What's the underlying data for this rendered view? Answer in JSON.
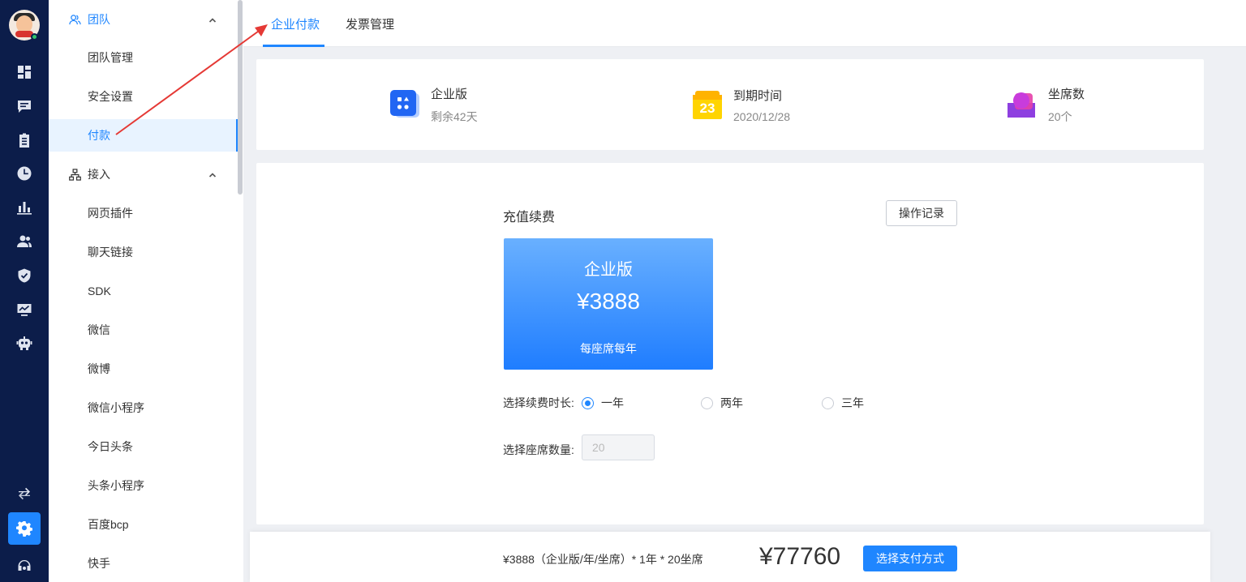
{
  "rail": {
    "icons": [
      "dashboard-icon",
      "chat-icon",
      "clipboard-icon",
      "clock-icon",
      "bar-chart-icon",
      "users-icon",
      "shield-icon",
      "monitor-icon",
      "robot-icon",
      "switch-icon",
      "settings-icon",
      "headset-icon"
    ],
    "active": "settings-icon"
  },
  "menu": {
    "groups": [
      {
        "label": "团队",
        "items": [
          "团队管理",
          "安全设置",
          "付款"
        ]
      },
      {
        "label": "接入",
        "items": [
          "网页插件",
          "聊天链接",
          "SDK",
          "微信",
          "微博",
          "微信小程序",
          "今日头条",
          "头条小程序",
          "百度bcp",
          "快手"
        ]
      }
    ],
    "active_item": "付款"
  },
  "tabs": [
    "企业付款",
    "发票管理"
  ],
  "active_tab": "企业付款",
  "stats": [
    {
      "label": "企业版",
      "sub": "剩余42天",
      "icon": "app-grid-icon"
    },
    {
      "label": "到期时间",
      "sub": "2020/12/28",
      "icon": "calendar-icon",
      "calendar_day": "23"
    },
    {
      "label": "坐席数",
      "sub": "20个",
      "icon": "seat-icon"
    }
  ],
  "recharge": {
    "title": "充值续费",
    "history_button": "操作记录",
    "plan": {
      "name": "企业版",
      "price": "¥3888",
      "unit": "每座席每年"
    },
    "duration_label": "选择续费时长:",
    "durations": [
      "一年",
      "两年",
      "三年"
    ],
    "selected_duration": "一年",
    "seat_label": "选择座席数量:",
    "seat_value": "20"
  },
  "footer": {
    "formula": "¥3888（企业版/年/坐席）* 1年 * 20坐席",
    "total": "¥77760",
    "pay_button": "选择支付方式"
  },
  "colors": {
    "accent": "#1f86ff",
    "rail_bg": "#0c1d4a",
    "annotation_arrow": "#e53935"
  }
}
